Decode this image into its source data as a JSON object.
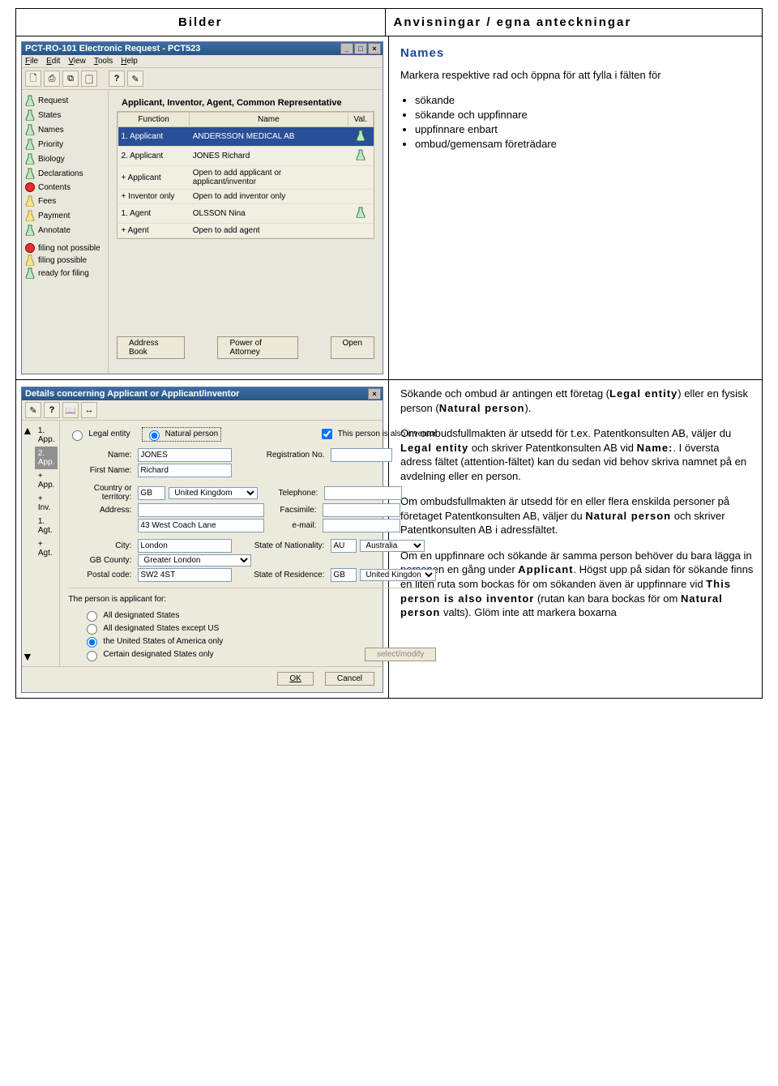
{
  "header": {
    "left": "Bilder",
    "right": "Anvisningar / egna anteckningar"
  },
  "row1": {
    "win": {
      "title": "PCT-RO-101 Electronic Request - PCT523",
      "menu": [
        "File",
        "Edit",
        "View",
        "Tools",
        "Help"
      ],
      "groupTitle": "Applicant, Inventor, Agent, Common Representative",
      "cols": {
        "func": "Function",
        "name": "Name",
        "val": "Val."
      },
      "rows": [
        {
          "f": "1. Applicant",
          "n": "ANDERSSON MEDICAL AB",
          "sel": true,
          "valIcon": "flask-green"
        },
        {
          "f": "2. Applicant",
          "n": "JONES Richard",
          "valIcon": "flask-green"
        },
        {
          "f": "+ Applicant",
          "n": "Open to add applicant or applicant/inventor"
        },
        {
          "f": "+ Inventor only",
          "n": "Open to add inventor only"
        },
        {
          "f": "1. Agent",
          "n": "OLSSON Nina",
          "valIcon": "flask-green"
        },
        {
          "f": "+ Agent",
          "n": "Open to add agent"
        }
      ],
      "sidebar": [
        "Request",
        "States",
        "Names",
        "Priority",
        "Biology",
        "Declarations",
        "Contents",
        "Fees",
        "Payment",
        "Annotate"
      ],
      "legend": [
        {
          "lbl": "filing not possible",
          "c": "#d33"
        },
        {
          "lbl": "filing possible",
          "c": "#e7c933"
        },
        {
          "lbl": "ready for filing",
          "c": "#49b84c"
        }
      ],
      "buttons": {
        "addr": "Address Book",
        "poa": "Power of Attorney",
        "open": "Open"
      }
    },
    "instr": {
      "title": "Names",
      "lead": "Markera respektive rad och öppna för att fylla i fälten för",
      "items": [
        "sökande",
        "sökande och uppfinnare",
        "uppfinnare enbart",
        "ombud/gemensam företrädare"
      ]
    }
  },
  "row2": {
    "dlg": {
      "title": "Details concerning Applicant or Applicant/inventor",
      "side": [
        "1. App.",
        "2. App.",
        "+ App.",
        "+ Inv.",
        "1. Agt.",
        "+ Agt."
      ],
      "sideSel": 1,
      "radio": {
        "legal": "Legal entity",
        "natural": "Natural person",
        "also": "This person is also inventor"
      },
      "labels": {
        "name": "Name:",
        "first": "First Name:",
        "regno": "Registration No.",
        "country": "Country or territory:",
        "addr": "Address:",
        "tel": "Telephone:",
        "fax": "Facsimile:",
        "email": "e-mail:",
        "city": "City:",
        "gbcty": "GB County:",
        "postal": "Postal code:",
        "nat": "State of Nationality:",
        "res": "State of Residence:"
      },
      "values": {
        "name": "JONES",
        "first": "Richard",
        "countryCode": "GB",
        "countryName": "United Kingdom",
        "addr2": "43 West Coach Lane",
        "city": "London",
        "gbcty": "Greater London",
        "postal": "SW2 4ST",
        "natCode": "AU",
        "natName": "Australia",
        "resCode": "GB",
        "resName": "United Kingdom"
      },
      "applicantFor": {
        "label": "The person is applicant for:",
        "opts": [
          "All designated States",
          "All designated States except US",
          "the United States of America only",
          "Certain designated States only"
        ],
        "sel": 2
      },
      "selmod": "select/modify",
      "ok": "OK",
      "cancel": "Cancel"
    },
    "text": {
      "p1a": "Sökande och ombud är antingen ett företag (",
      "p1b": "Legal entity",
      "p1c": ") eller en fysisk person (",
      "p1d": "Natural person",
      "p1e": ").",
      "p2a": "Om ombudsfullmakten är utsedd för t.ex. Patentkonsulten AB, väljer du ",
      "p2b": "Legal entity",
      "p2c": " och skriver Patentkonsulten AB vid ",
      "p2d": "Name:",
      "p2e": ". I översta adress fältet (attention-fältet) kan du sedan vid behov skriva namnet på en avdelning eller en person.",
      "p3a": "Om ombudsfullmakten är utsedd för en eller flera enskilda personer på företaget Patentkonsulten AB, väljer du ",
      "p3b": "Natural person",
      "p3c": " och skriver Patentkonsulten AB i adressfältet.",
      "p4a": "Om en uppfinnare och sökande är samma person behöver du bara lägga in personen en gång under ",
      "p4b": "Applicant",
      "p4c": ". Högst upp på sidan för sökande finns en liten ruta som bockas för om sökanden även är uppfinnare vid ",
      "p4d": "This person is also inventor",
      "p4e": " (rutan kan bara bockas för om ",
      "p4f": "Natural person",
      "p4g": " valts). Glöm inte att markera boxarna"
    }
  }
}
